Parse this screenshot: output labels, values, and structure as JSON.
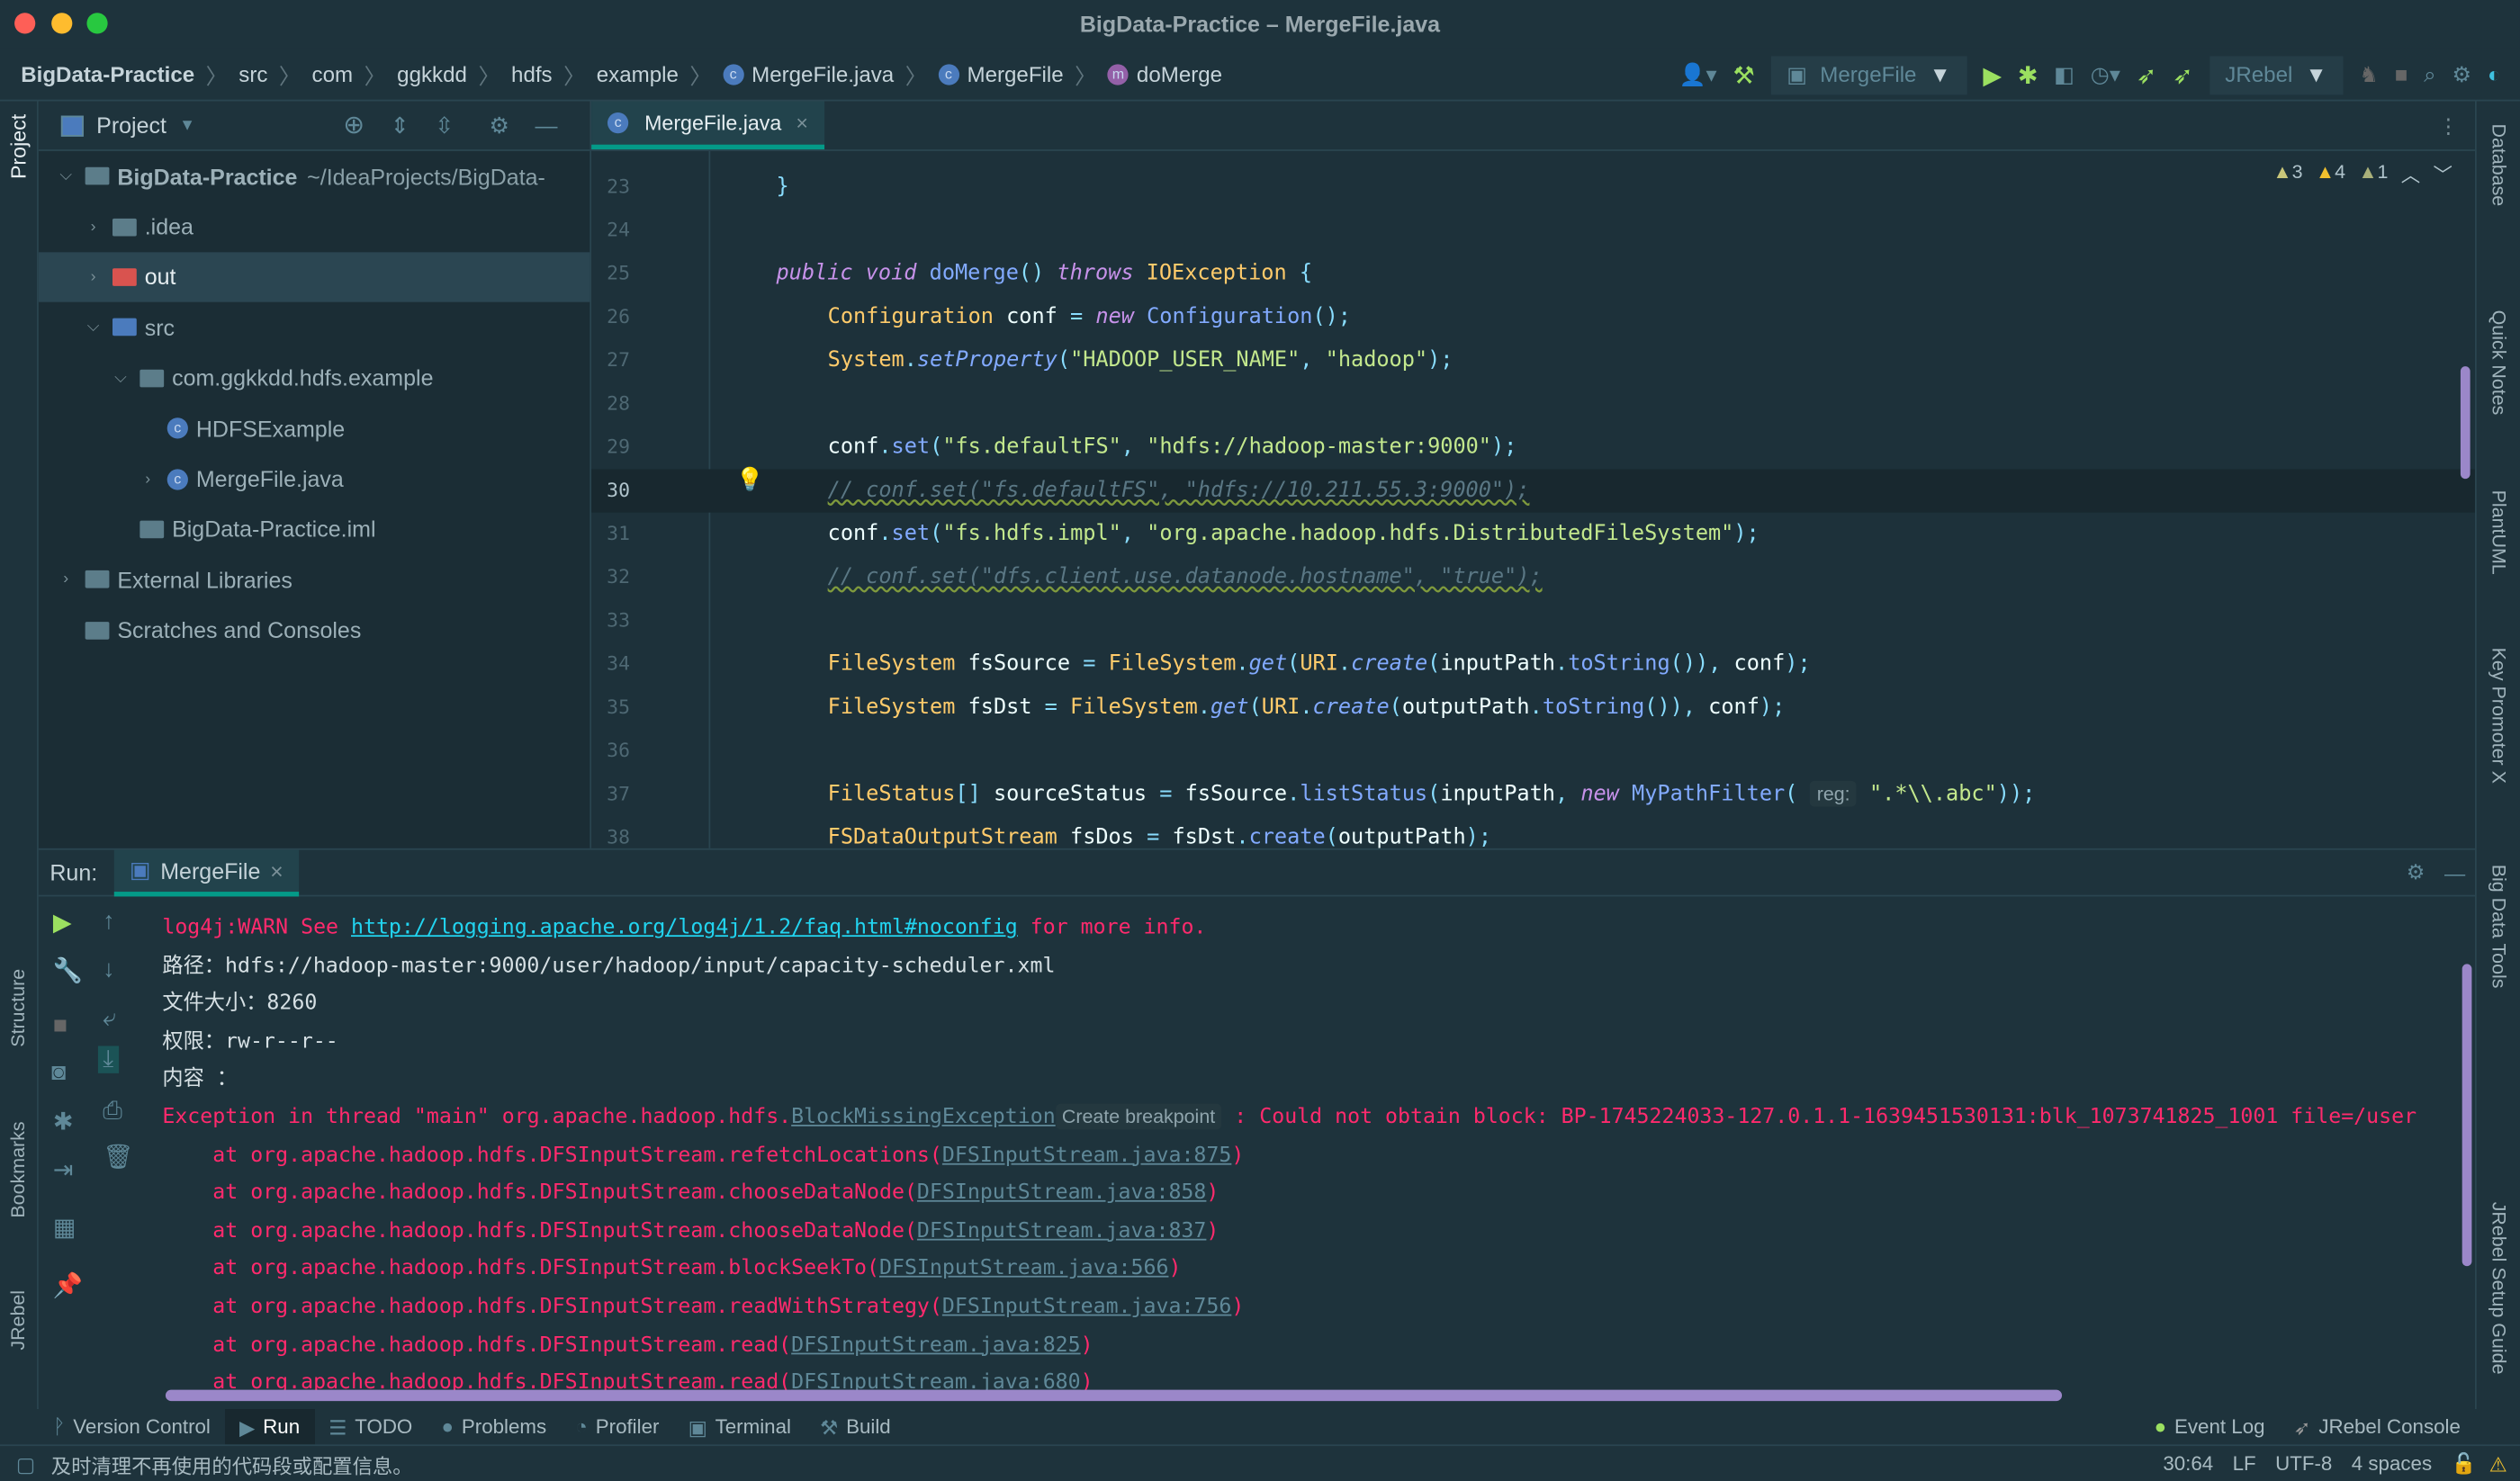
{
  "window": {
    "title": "BigData-Practice – MergeFile.java"
  },
  "breadcrumb": [
    "BigData-Practice",
    "src",
    "com",
    "ggkkdd",
    "hdfs",
    "example",
    "MergeFile.java",
    "MergeFile",
    "doMerge"
  ],
  "toolbar": {
    "run_config": "MergeFile",
    "jrebel": "JRebel"
  },
  "left_stripe": {
    "project": "Project",
    "structure": "Structure",
    "bookmarks": "Bookmarks",
    "jrebel": "JRebel"
  },
  "right_stripe": [
    "Database",
    "Quick Notes",
    "PlantUML",
    "Key Promoter X",
    "Big Data Tools",
    "JRebel Setup Guide"
  ],
  "project": {
    "title": "Project",
    "tree": [
      {
        "label": "BigData-Practice",
        "extra": "~/IdeaProjects/BigData-",
        "arrow": "v",
        "indent": 0,
        "bold": true
      },
      {
        "label": ".idea",
        "arrow": ">",
        "indent": 1
      },
      {
        "label": "out",
        "arrow": ">",
        "indent": 1,
        "selected": true,
        "red": true
      },
      {
        "label": "src",
        "arrow": "v",
        "indent": 1
      },
      {
        "label": "com.ggkkdd.hdfs.example",
        "arrow": "v",
        "indent": 2
      },
      {
        "label": "HDFSExample",
        "arrow": "",
        "indent": 3,
        "cls": true
      },
      {
        "label": "MergeFile.java",
        "arrow": ">",
        "indent": 3,
        "cls": true
      },
      {
        "label": "BigData-Practice.iml",
        "arrow": "",
        "indent": 2
      },
      {
        "label": "External Libraries",
        "arrow": ">",
        "indent": 0
      },
      {
        "label": "Scratches and Consoles",
        "arrow": "",
        "indent": 0
      }
    ]
  },
  "editor": {
    "tab": "MergeFile.java",
    "inspections": {
      "weak_warnings": "3",
      "warnings": "4",
      "typos": "1"
    },
    "current_line": 30,
    "lines": [
      {
        "n": "23",
        "tokens": [
          [
            "o",
            "}"
          ]
        ],
        "indent": 0
      },
      {
        "n": "24",
        "tokens": []
      },
      {
        "n": "25",
        "indent": 0,
        "tokens": [
          [
            "k",
            "public void "
          ],
          [
            "m",
            "doMerge"
          ],
          [
            "o",
            "() "
          ],
          [
            "k",
            "throws "
          ],
          [
            "t",
            "IOException "
          ],
          [
            "o",
            "{"
          ]
        ]
      },
      {
        "n": "26",
        "indent": 1,
        "tokens": [
          [
            "t",
            "Configuration "
          ],
          [
            "p",
            "conf "
          ],
          [
            "o",
            "= "
          ],
          [
            "k",
            "new "
          ],
          [
            "m",
            "Configuration"
          ],
          [
            "o",
            "();"
          ]
        ]
      },
      {
        "n": "27",
        "indent": 1,
        "tokens": [
          [
            "t",
            "System"
          ],
          [
            "o",
            "."
          ],
          [
            "mi",
            "setProperty"
          ],
          [
            "o",
            "("
          ],
          [
            "s",
            "\"HADOOP_USER_NAME\""
          ],
          [
            "o",
            ", "
          ],
          [
            "s",
            "\"hadoop\""
          ],
          [
            "o",
            ");"
          ]
        ]
      },
      {
        "n": "28",
        "tokens": []
      },
      {
        "n": "29",
        "indent": 1,
        "tokens": [
          [
            "p",
            "conf"
          ],
          [
            "o",
            "."
          ],
          [
            "m",
            "set"
          ],
          [
            "o",
            "("
          ],
          [
            "s",
            "\"fs.defaultFS\""
          ],
          [
            "o",
            ", "
          ],
          [
            "s",
            "\"hdfs://hadoop-master:9000\""
          ],
          [
            "o",
            ");"
          ]
        ]
      },
      {
        "n": "30",
        "indent": 1,
        "tokens": [
          [
            "c",
            "// conf.set(\"fs.defaultFS\", \"hdfs://10.211.55.3:9000\");"
          ]
        ]
      },
      {
        "n": "31",
        "indent": 1,
        "tokens": [
          [
            "p",
            "conf"
          ],
          [
            "o",
            "."
          ],
          [
            "m",
            "set"
          ],
          [
            "o",
            "("
          ],
          [
            "s",
            "\"fs.hdfs.impl\""
          ],
          [
            "o",
            ", "
          ],
          [
            "s",
            "\"org.apache.hadoop.hdfs.DistributedFileSystem\""
          ],
          [
            "o",
            ");"
          ]
        ]
      },
      {
        "n": "32",
        "indent": 1,
        "tokens": [
          [
            "c",
            "// conf.set(\"dfs.client.use.datanode.hostname\", \"true\");"
          ]
        ]
      },
      {
        "n": "33",
        "tokens": []
      },
      {
        "n": "34",
        "indent": 1,
        "tokens": [
          [
            "t",
            "FileSystem "
          ],
          [
            "p",
            "fsSource "
          ],
          [
            "o",
            "= "
          ],
          [
            "t",
            "FileSystem"
          ],
          [
            "o",
            "."
          ],
          [
            "mi",
            "get"
          ],
          [
            "o",
            "("
          ],
          [
            "t",
            "URI"
          ],
          [
            "o",
            "."
          ],
          [
            "mi",
            "create"
          ],
          [
            "o",
            "("
          ],
          [
            "p",
            "inputPath"
          ],
          [
            "o",
            "."
          ],
          [
            "m",
            "toString"
          ],
          [
            "o",
            "()), "
          ],
          [
            "p",
            "conf"
          ],
          [
            "o",
            ");"
          ]
        ]
      },
      {
        "n": "35",
        "indent": 1,
        "tokens": [
          [
            "t",
            "FileSystem "
          ],
          [
            "p",
            "fsDst "
          ],
          [
            "o",
            "= "
          ],
          [
            "t",
            "FileSystem"
          ],
          [
            "o",
            "."
          ],
          [
            "mi",
            "get"
          ],
          [
            "o",
            "("
          ],
          [
            "t",
            "URI"
          ],
          [
            "o",
            "."
          ],
          [
            "mi",
            "create"
          ],
          [
            "o",
            "("
          ],
          [
            "p",
            "outputPath"
          ],
          [
            "o",
            "."
          ],
          [
            "m",
            "toString"
          ],
          [
            "o",
            "()), "
          ],
          [
            "p",
            "conf"
          ],
          [
            "o",
            ");"
          ]
        ]
      },
      {
        "n": "36",
        "tokens": []
      },
      {
        "n": "37",
        "indent": 1,
        "tokens": [
          [
            "t",
            "FileStatus"
          ],
          [
            "o",
            "[] "
          ],
          [
            "p",
            "sourceStatus "
          ],
          [
            "o",
            "= "
          ],
          [
            "p",
            "fsSource"
          ],
          [
            "o",
            "."
          ],
          [
            "m",
            "listStatus"
          ],
          [
            "o",
            "("
          ],
          [
            "p",
            "inputPath"
          ],
          [
            "o",
            ", "
          ],
          [
            "k",
            "new "
          ],
          [
            "m",
            "MyPathFilter"
          ],
          [
            "o",
            "( "
          ],
          [
            "h",
            "reg:"
          ],
          [
            "s",
            " \".*\\\\.abc\""
          ],
          [
            "o",
            "));"
          ]
        ]
      },
      {
        "n": "38",
        "indent": 1,
        "tokens": [
          [
            "t",
            "FSDataOutputStream "
          ],
          [
            "p",
            "fsDos "
          ],
          [
            "o",
            "= "
          ],
          [
            "p",
            "fsDst"
          ],
          [
            "o",
            "."
          ],
          [
            "m",
            "create"
          ],
          [
            "o",
            "("
          ],
          [
            "p",
            "outputPath"
          ],
          [
            "o",
            ");"
          ]
        ]
      }
    ]
  },
  "run": {
    "label": "Run:",
    "tab": "MergeFile",
    "output": [
      [
        [
          "err",
          "log4j:WARN See "
        ],
        [
          "lnk",
          "http://logging.apache.org/log4j/1.2/faq.html#noconfig"
        ],
        [
          "err",
          " for more info."
        ]
      ],
      [
        [
          "norm",
          "路径：hdfs://hadoop-master:9000/user/hadoop/input/capacity-scheduler.xml"
        ]
      ],
      [
        [
          "norm",
          "文件大小：8260"
        ]
      ],
      [
        [
          "norm",
          "权限：rw-r--r--"
        ]
      ],
      [
        [
          "norm",
          "内容 ："
        ]
      ],
      [
        [
          "err",
          "Exception in thread \"main\" org.apache.hadoop.hdfs."
        ],
        [
          "flnk",
          "BlockMissingException"
        ],
        [
          "h",
          "Create breakpoint"
        ],
        [
          "err",
          " : Could not obtain block: BP-1745224033-127.0.1.1-1639451530131:blk_1073741825_1001 file=/user"
        ]
      ],
      [
        [
          "err",
          "    at org.apache.hadoop.hdfs.DFSInputStream.refetchLocations("
        ],
        [
          "flnk",
          "DFSInputStream.java:875"
        ],
        [
          "err",
          ")"
        ]
      ],
      [
        [
          "err",
          "    at org.apache.hadoop.hdfs.DFSInputStream.chooseDataNode("
        ],
        [
          "flnk",
          "DFSInputStream.java:858"
        ],
        [
          "err",
          ")"
        ]
      ],
      [
        [
          "err",
          "    at org.apache.hadoop.hdfs.DFSInputStream.chooseDataNode("
        ],
        [
          "flnk",
          "DFSInputStream.java:837"
        ],
        [
          "err",
          ")"
        ]
      ],
      [
        [
          "err",
          "    at org.apache.hadoop.hdfs.DFSInputStream.blockSeekTo("
        ],
        [
          "flnk",
          "DFSInputStream.java:566"
        ],
        [
          "err",
          ")"
        ]
      ],
      [
        [
          "err",
          "    at org.apache.hadoop.hdfs.DFSInputStream.readWithStrategy("
        ],
        [
          "flnk",
          "DFSInputStream.java:756"
        ],
        [
          "err",
          ")"
        ]
      ],
      [
        [
          "err",
          "    at org.apache.hadoop.hdfs.DFSInputStream.read("
        ],
        [
          "flnk",
          "DFSInputStream.java:825"
        ],
        [
          "err",
          ")"
        ]
      ],
      [
        [
          "err",
          "    at org.apache.hadoop.hdfs.DFSInputStream.read("
        ],
        [
          "flnk",
          "DFSInputStream.java:680"
        ],
        [
          "err",
          ")"
        ]
      ]
    ]
  },
  "bottom_tools": [
    {
      "label": "Version Control",
      "icon": "branch-icon",
      "glyph": "ᚹ"
    },
    {
      "label": "Run",
      "icon": "play-icon",
      "glyph": "▶",
      "active": true
    },
    {
      "label": "TODO",
      "icon": "list-icon",
      "glyph": "☰"
    },
    {
      "label": "Problems",
      "icon": "problems-icon",
      "glyph": "●"
    },
    {
      "label": "Profiler",
      "icon": "profiler-icon",
      "glyph": "◔"
    },
    {
      "label": "Terminal",
      "icon": "terminal-icon",
      "glyph": "▣"
    },
    {
      "label": "Build",
      "icon": "hammer-icon",
      "glyph": "⚒"
    }
  ],
  "bottom_right_tools": [
    {
      "label": "Event Log",
      "icon": "event-log-icon"
    },
    {
      "label": "JRebel Console",
      "icon": "jrebel-icon"
    }
  ],
  "status": {
    "message": "及时清理不再使用的代码段或配置信息。",
    "position": "30:64",
    "line_sep": "LF",
    "encoding": "UTF-8",
    "indent": "4 spaces"
  },
  "colors": {
    "background": "#1e333c",
    "accent": "#049a88",
    "error": "#ff2a6d",
    "link": "#22d4f0",
    "scrollbar": "#9b87c9"
  }
}
